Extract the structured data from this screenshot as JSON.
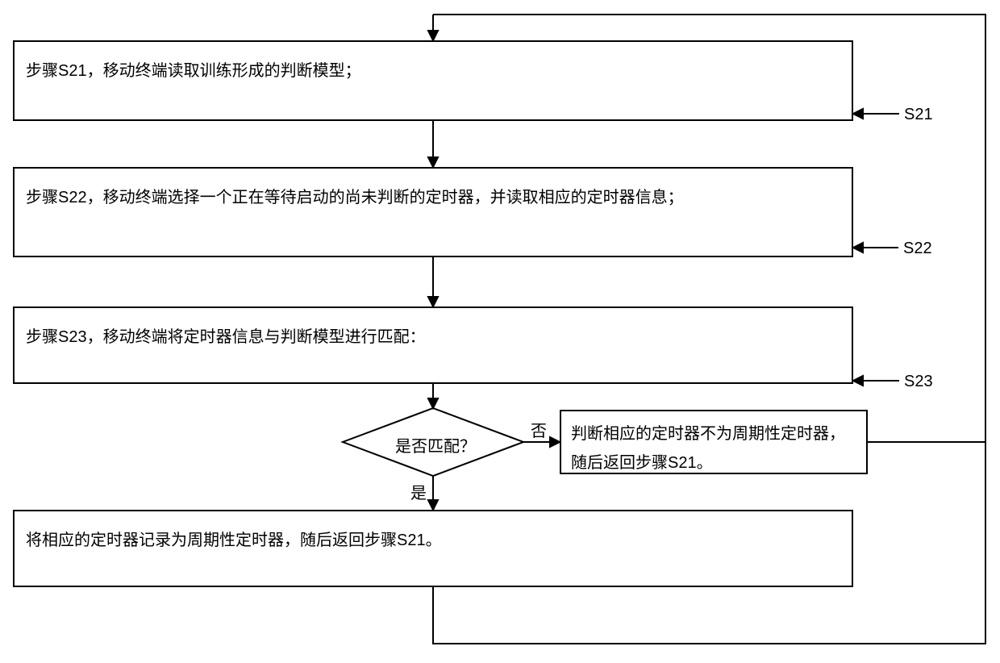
{
  "boxes": {
    "s21": "步骤S21，移动终端读取训练形成的判断模型；",
    "s22": "步骤S22，移动终端选择一个正在等待启动的尚未判断的定时器，并读取相应的定时器信息；",
    "s23": "步骤S23，移动终端将定时器信息与判断模型进行匹配：",
    "decision": "是否匹配？",
    "no_result": "判断相应的定时器不为周期性定时器，随后返回步骤S21。",
    "final": "将相应的定时器记录为周期性定时器，随后返回步骤S21。"
  },
  "labels": {
    "s21_tag": "S21",
    "s22_tag": "S22",
    "s23_tag": "S23",
    "yes": "是",
    "no": "否"
  }
}
